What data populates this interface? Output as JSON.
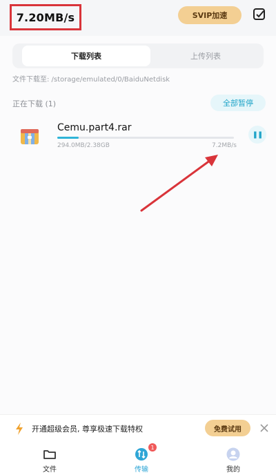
{
  "header": {
    "speed": "7.20MB/s",
    "svip_button": "SVIP加速"
  },
  "tabs": [
    {
      "label": "下载列表",
      "active": true
    },
    {
      "label": "上传列表",
      "active": false
    }
  ],
  "download_path": "文件下载至: /storage/emulated/0/BaiduNetdisk",
  "section": {
    "title": "正在下载 (1)",
    "pause_all": "全部暂停"
  },
  "download_item": {
    "file_name": "Cemu.part4.rar",
    "size_progress": "294.0MB/2.38GB",
    "speed": "7.2MB/s",
    "progress_fraction": 0.12
  },
  "promo": {
    "text": "开通超级会员, 尊享极速下载特权",
    "button": "免费试用"
  },
  "bottom_nav": [
    {
      "label": "文件",
      "icon": "folder-icon",
      "active": false
    },
    {
      "label": "传输",
      "icon": "transfer-icon",
      "active": true,
      "badge": "1"
    },
    {
      "label": "我的",
      "icon": "avatar-icon",
      "active": false
    }
  ],
  "colors": {
    "accent": "#2fb4d8",
    "svip_gold": "#f3cf93",
    "annotation_red": "#d9343a"
  }
}
